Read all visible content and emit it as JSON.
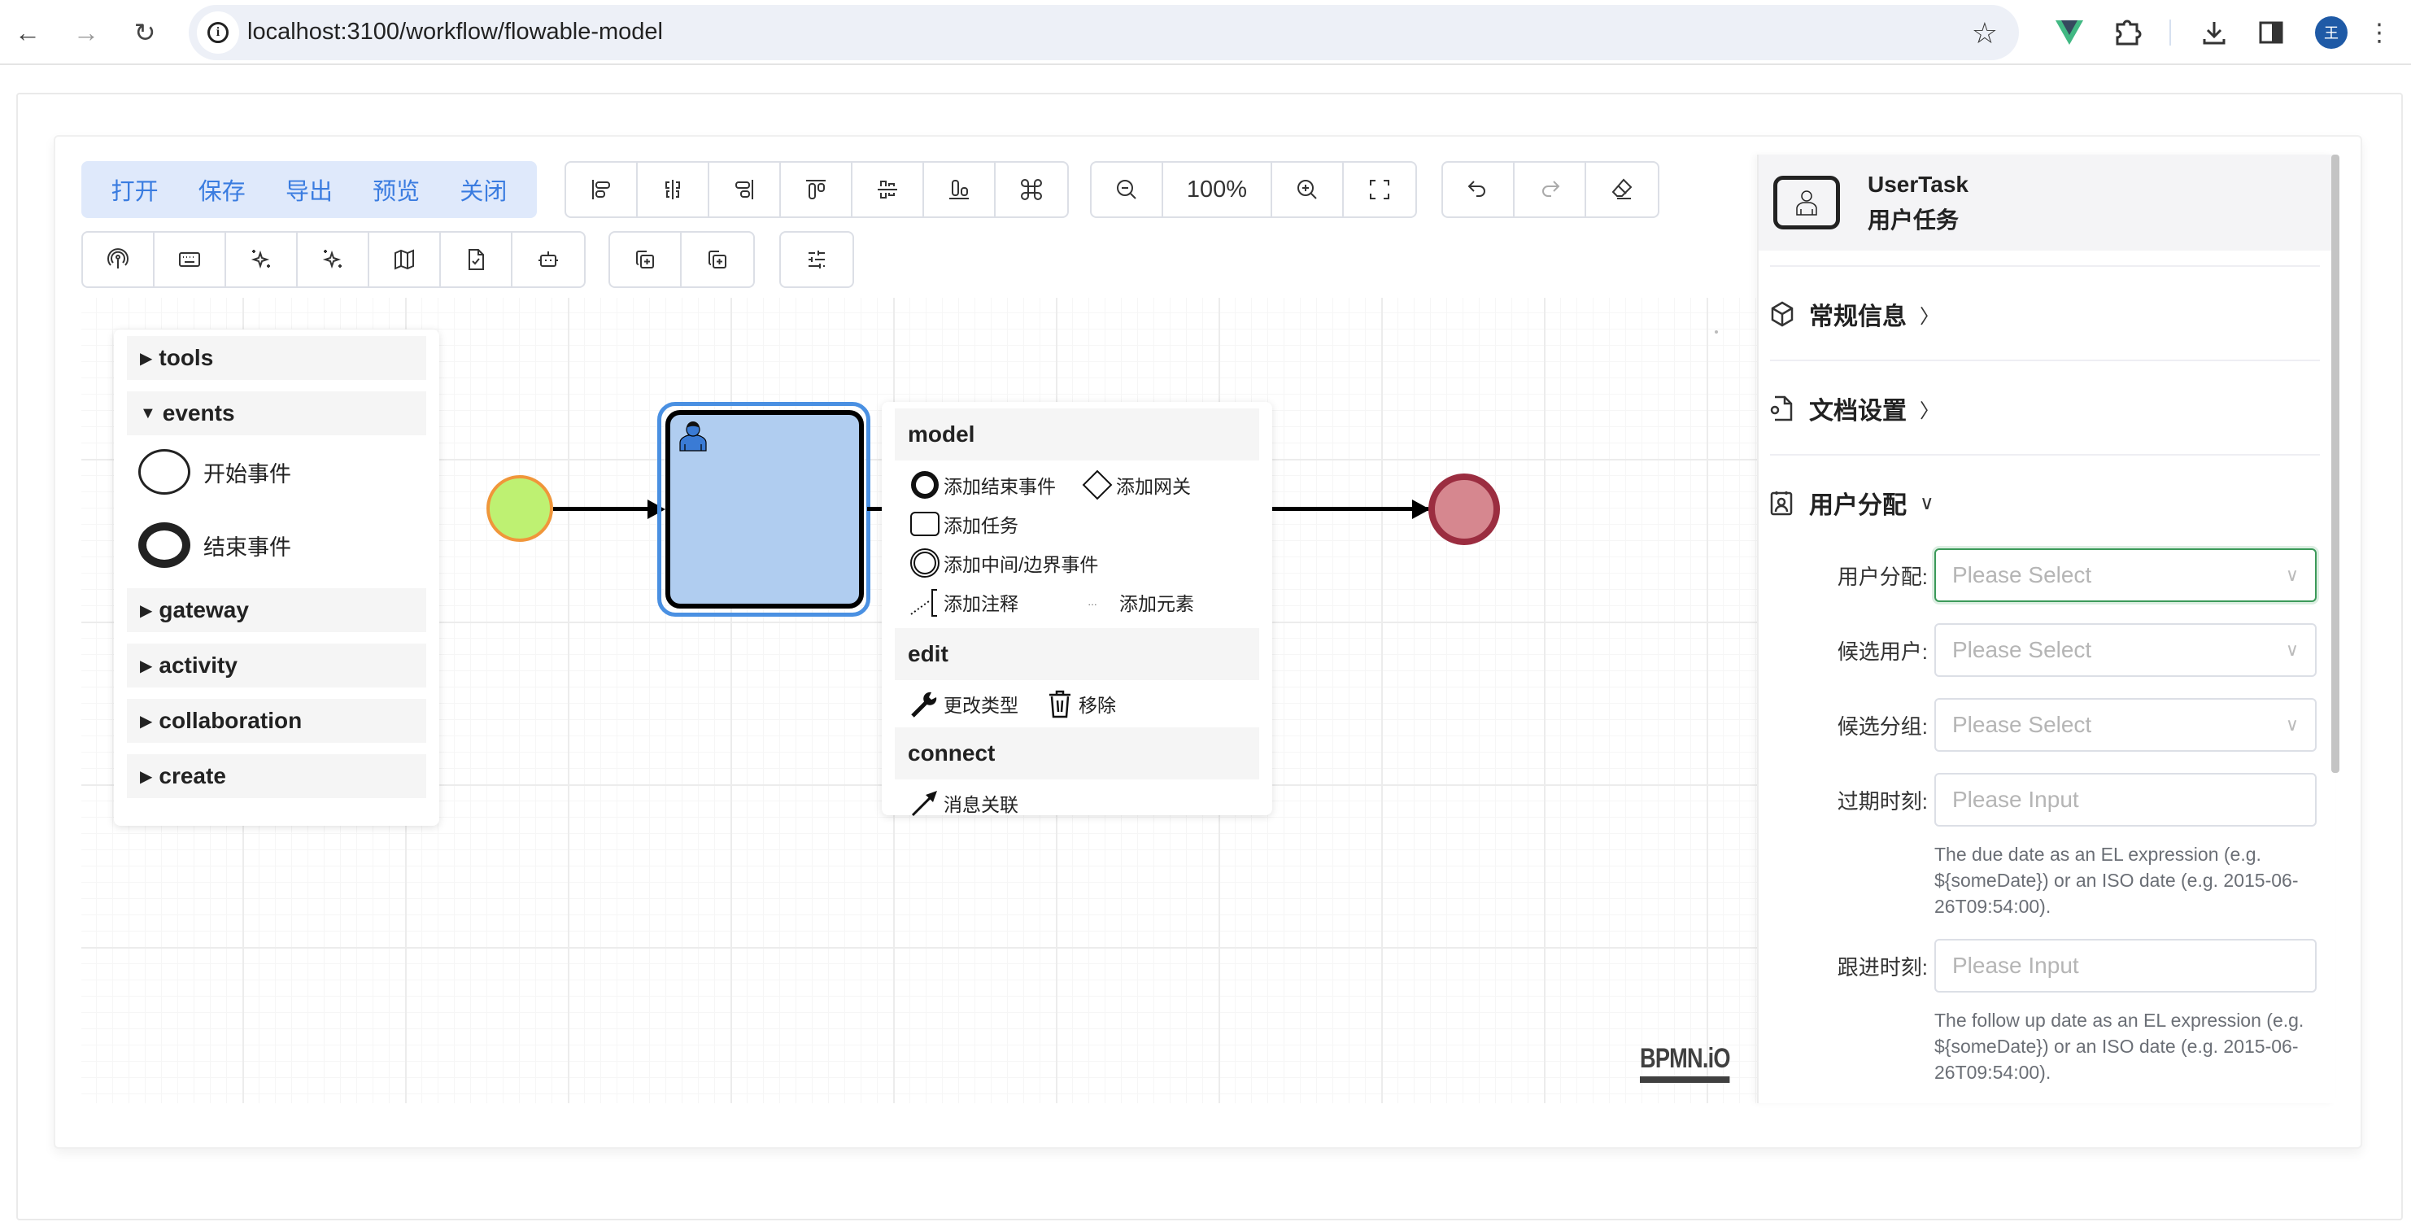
{
  "browser": {
    "url": "localhost:3100/workflow/flowable-model",
    "profile_initial": "王"
  },
  "toolbar": {
    "menu": [
      "打开",
      "保存",
      "导出",
      "预览",
      "关闭"
    ],
    "align_buttons": [
      "align-left",
      "align-center-horizontal",
      "align-right",
      "align-top",
      "align-middle-vertical",
      "align-bottom",
      "command"
    ],
    "zoom": {
      "value": "100%"
    },
    "history_buttons": [
      "undo",
      "redo",
      "eraser"
    ],
    "redo_disabled": true,
    "tool_buttons": [
      "podcast",
      "keyboard",
      "sparkles",
      "sparkles",
      "map",
      "file-check",
      "bot"
    ],
    "copy_buttons": [
      "copy-plus",
      "copy-plus"
    ],
    "settings_button": "sliders"
  },
  "palette": {
    "groups": [
      {
        "label": "tools",
        "expanded": false
      },
      {
        "label": "events",
        "expanded": true
      },
      {
        "label": "gateway",
        "expanded": false
      },
      {
        "label": "activity",
        "expanded": false
      },
      {
        "label": "collaboration",
        "expanded": false
      },
      {
        "label": "create",
        "expanded": false
      }
    ],
    "event_entries": [
      "开始事件",
      "结束事件"
    ]
  },
  "diagram": {
    "start_event": {
      "fill": "#bef172",
      "stroke": "#f0963a"
    },
    "user_task": {
      "fill": "#b0cdf0",
      "selected": true
    },
    "end_event": {
      "fill": "#d6878f",
      "stroke": "#9b2d40"
    },
    "watermark": "BPMN.iO"
  },
  "context_pad": {
    "model_label": "model",
    "model_items": [
      "添加结束事件",
      "添加网关",
      "添加任务",
      "添加中间/边界事件",
      "添加注释",
      "添加元素"
    ],
    "edit_label": "edit",
    "edit_items": [
      "更改类型",
      "移除"
    ],
    "connect_label": "connect",
    "connect_items": [
      "消息关联"
    ]
  },
  "properties": {
    "element_type": "UserTask",
    "element_name": "用户任务",
    "sections": [
      {
        "label": "常规信息",
        "expanded": false
      },
      {
        "label": "文档设置",
        "expanded": false
      },
      {
        "label": "用户分配",
        "expanded": true
      }
    ],
    "fields": [
      {
        "label": "用户分配:",
        "placeholder": "Please Select",
        "type": "select"
      },
      {
        "label": "候选用户:",
        "placeholder": "Please Select",
        "type": "select"
      },
      {
        "label": "候选分组:",
        "placeholder": "Please Select",
        "type": "select"
      },
      {
        "label": "过期时刻:",
        "placeholder": "Please Input",
        "type": "input",
        "help": "The due date as an EL expression (e.g. ${someDate}) or an ISO date (e.g. 2015-06-26T09:54:00)."
      },
      {
        "label": "跟进时刻:",
        "placeholder": "Please Input",
        "type": "input",
        "help": "The follow up date as an EL expression (e.g. ${someDate}) or an ISO date (e.g. 2015-06-26T09:54:00)."
      }
    ]
  }
}
